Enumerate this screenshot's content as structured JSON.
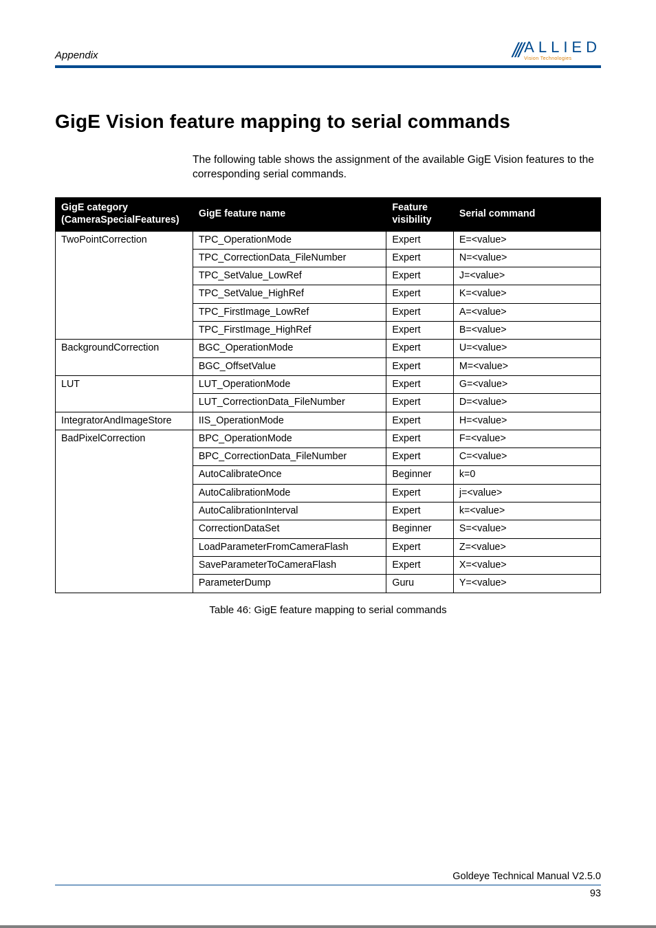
{
  "header": {
    "section": "Appendix",
    "logo_top": "ALLIED",
    "logo_sub": "Vision Technologies",
    "logo_slashes": "///"
  },
  "title": "GigE Vision feature mapping to serial commands",
  "intro": "The following table shows the assignment of the available GigE Vision features to the corresponding serial commands.",
  "table": {
    "headers": {
      "c1a": "GigE category",
      "c1b": "(CameraSpecialFeatures)",
      "c2": "GigE feature name",
      "c3a": "Feature",
      "c3b": "visibility",
      "c4": "Serial command"
    },
    "rows": [
      {
        "cat": "TwoPointCorrection",
        "feat": "TPC_OperationMode",
        "vis": "Expert",
        "cmd": "E=<value>"
      },
      {
        "cat": "",
        "feat": "TPC_CorrectionData_FileNumber",
        "vis": "Expert",
        "cmd": "N=<value>"
      },
      {
        "cat": "",
        "feat": "TPC_SetValue_LowRef",
        "vis": "Expert",
        "cmd": "J=<value>"
      },
      {
        "cat": "",
        "feat": "TPC_SetValue_HighRef",
        "vis": "Expert",
        "cmd": "K=<value>"
      },
      {
        "cat": "",
        "feat": "TPC_FirstImage_LowRef",
        "vis": "Expert",
        "cmd": "A=<value>"
      },
      {
        "cat": "",
        "feat": "TPC_FirstImage_HighRef",
        "vis": "Expert",
        "cmd": "B=<value>"
      },
      {
        "cat": "BackgroundCorrection",
        "feat": "BGC_OperationMode",
        "vis": "Expert",
        "cmd": "U=<value>"
      },
      {
        "cat": "",
        "feat": "BGC_OffsetValue",
        "vis": "Expert",
        "cmd": "M=<value>"
      },
      {
        "cat": "LUT",
        "feat": "LUT_OperationMode",
        "vis": "Expert",
        "cmd": "G=<value>"
      },
      {
        "cat": "",
        "feat": "LUT_CorrectionData_FileNumber",
        "vis": "Expert",
        "cmd": "D=<value>"
      },
      {
        "cat": "IntegratorAndImageStore",
        "feat": "IIS_OperationMode",
        "vis": "Expert",
        "cmd": "H=<value>"
      },
      {
        "cat": "BadPixelCorrection",
        "feat": "BPC_OperationMode",
        "vis": "Expert",
        "cmd": "F=<value>"
      },
      {
        "cat": "",
        "feat": "BPC_CorrectionData_FileNumber",
        "vis": "Expert",
        "cmd": "C=<value>"
      },
      {
        "cat": "",
        "feat": "AutoCalibrateOnce",
        "vis": "Beginner",
        "cmd": "k=0"
      },
      {
        "cat": "",
        "feat": "AutoCalibrationMode",
        "vis": "Expert",
        "cmd": "j=<value>"
      },
      {
        "cat": "",
        "feat": "AutoCalibrationInterval",
        "vis": "Expert",
        "cmd": "k=<value>"
      },
      {
        "cat": "",
        "feat": "CorrectionDataSet",
        "vis": "Beginner",
        "cmd": "S=<value>"
      },
      {
        "cat": "",
        "feat": "LoadParameterFromCameraFlash",
        "vis": "Expert",
        "cmd": "Z=<value>"
      },
      {
        "cat": "",
        "feat": "SaveParameterToCameraFlash",
        "vis": "Expert",
        "cmd": "X=<value>"
      },
      {
        "cat": "",
        "feat": "ParameterDump",
        "vis": "Guru",
        "cmd": "Y=<value>"
      }
    ]
  },
  "caption": "Table 46: GigE feature mapping to serial commands",
  "footer": {
    "doc": "Goldeye Technical Manual V2.5.0",
    "page": "93"
  }
}
